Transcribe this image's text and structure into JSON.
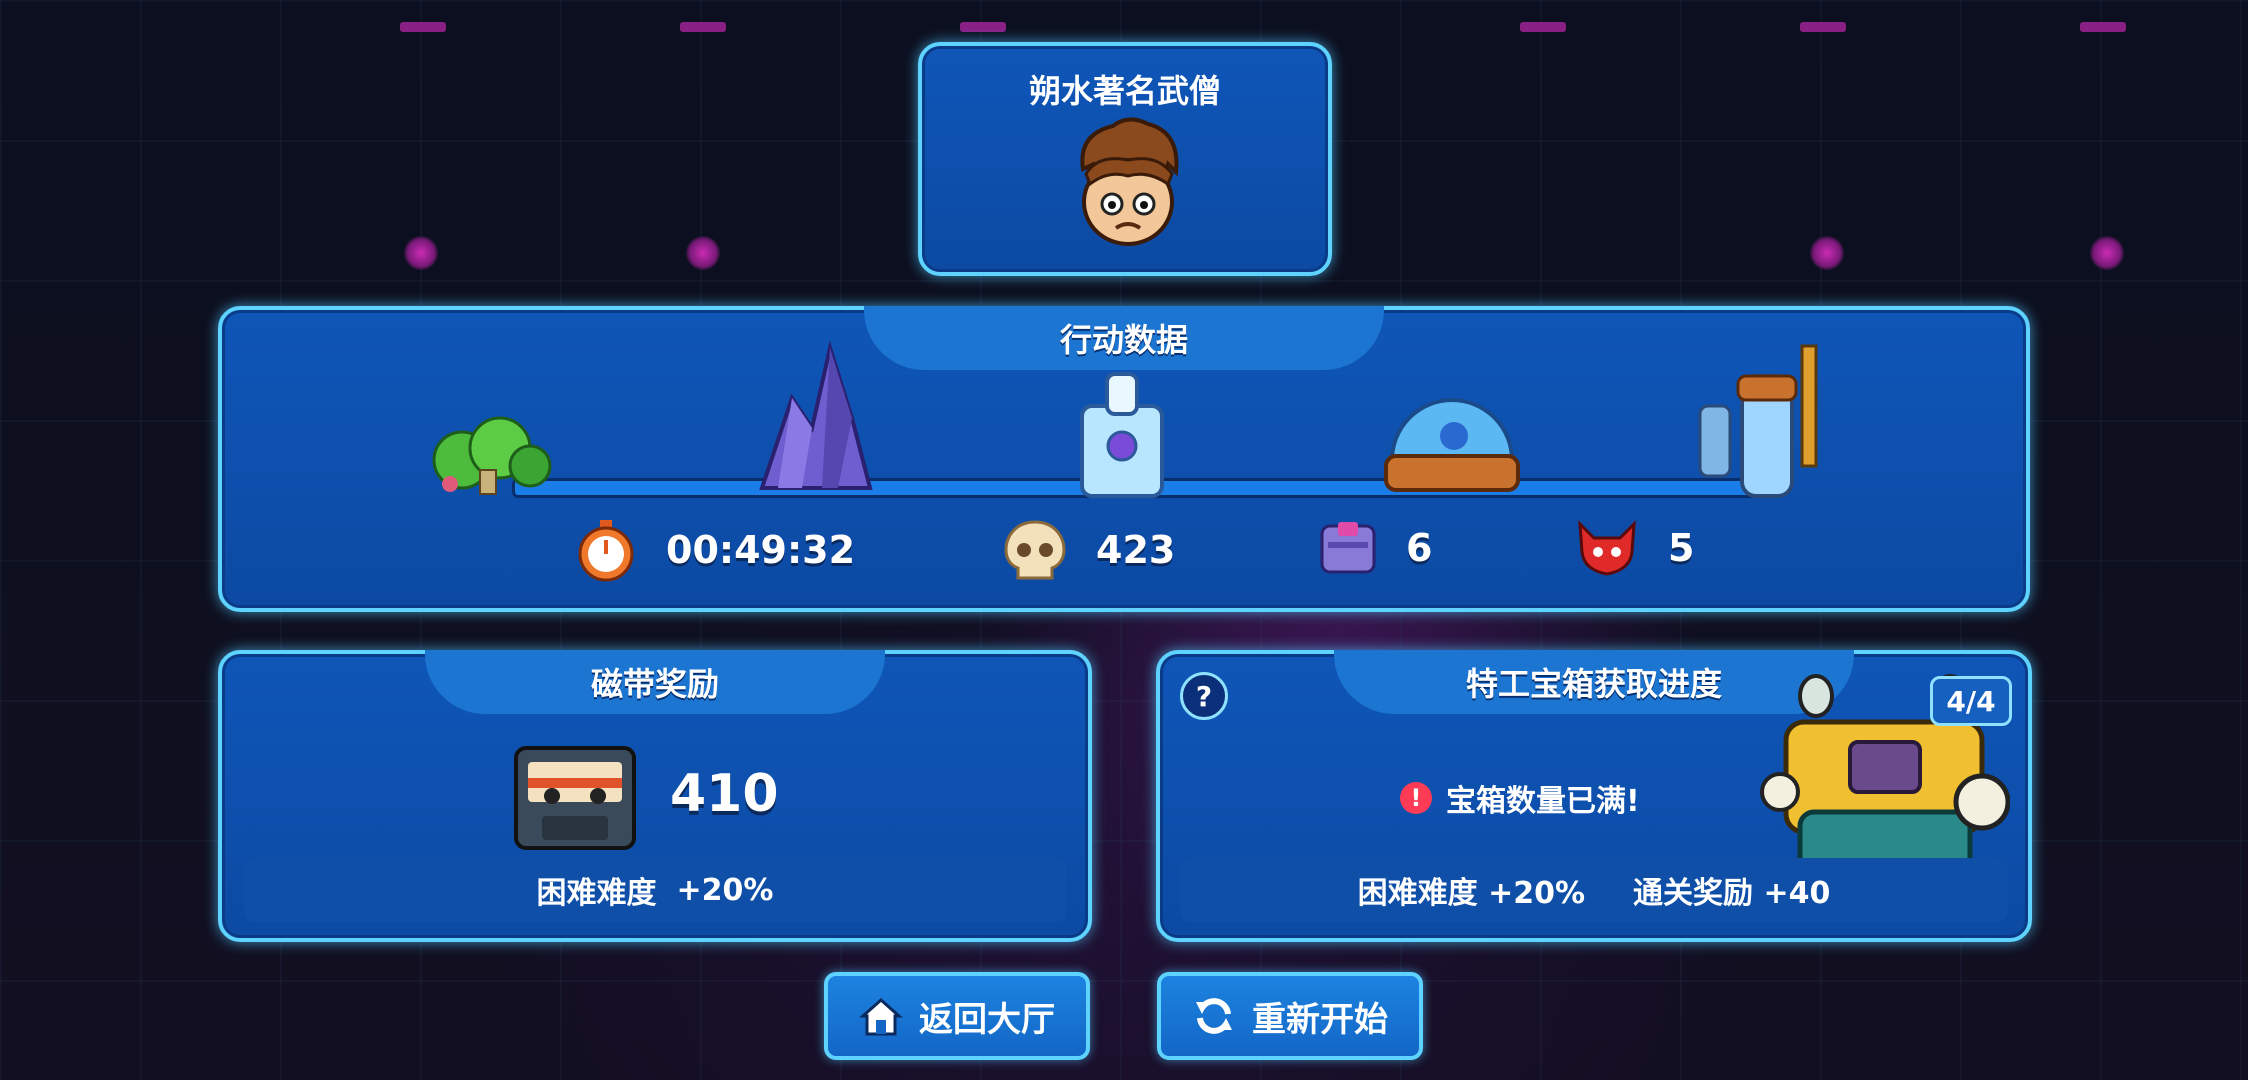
{
  "player": {
    "name": "朔水著名武僧",
    "avatar_icon": "monk-face-avatar"
  },
  "stats_panel": {
    "title": "行动数据",
    "stages": [
      "forest-stage-icon",
      "crystal-stage-icon",
      "lab-stage-icon",
      "dome-stage-icon",
      "factory-stage-icon"
    ],
    "time": "00:49:32",
    "kills": "423",
    "chests": "6",
    "bosses": "5"
  },
  "tape_reward": {
    "title": "磁带奖励",
    "amount": "410",
    "bonus_label": "困难难度",
    "bonus_value": "+20%"
  },
  "chest_progress": {
    "title": "特工宝箱获取进度",
    "help": "?",
    "progress": "4/4",
    "message": "宝箱数量已满!",
    "alert": "!",
    "bonus_label": "困难难度",
    "bonus_value": "+20%",
    "clear_label": "通关奖励",
    "clear_value": "+40"
  },
  "buttons": {
    "home": "返回大厅",
    "restart": "重新开始"
  },
  "colors": {
    "panel": "#0f56b8",
    "border": "#5fd3ff",
    "accent": "#1b75d1"
  }
}
